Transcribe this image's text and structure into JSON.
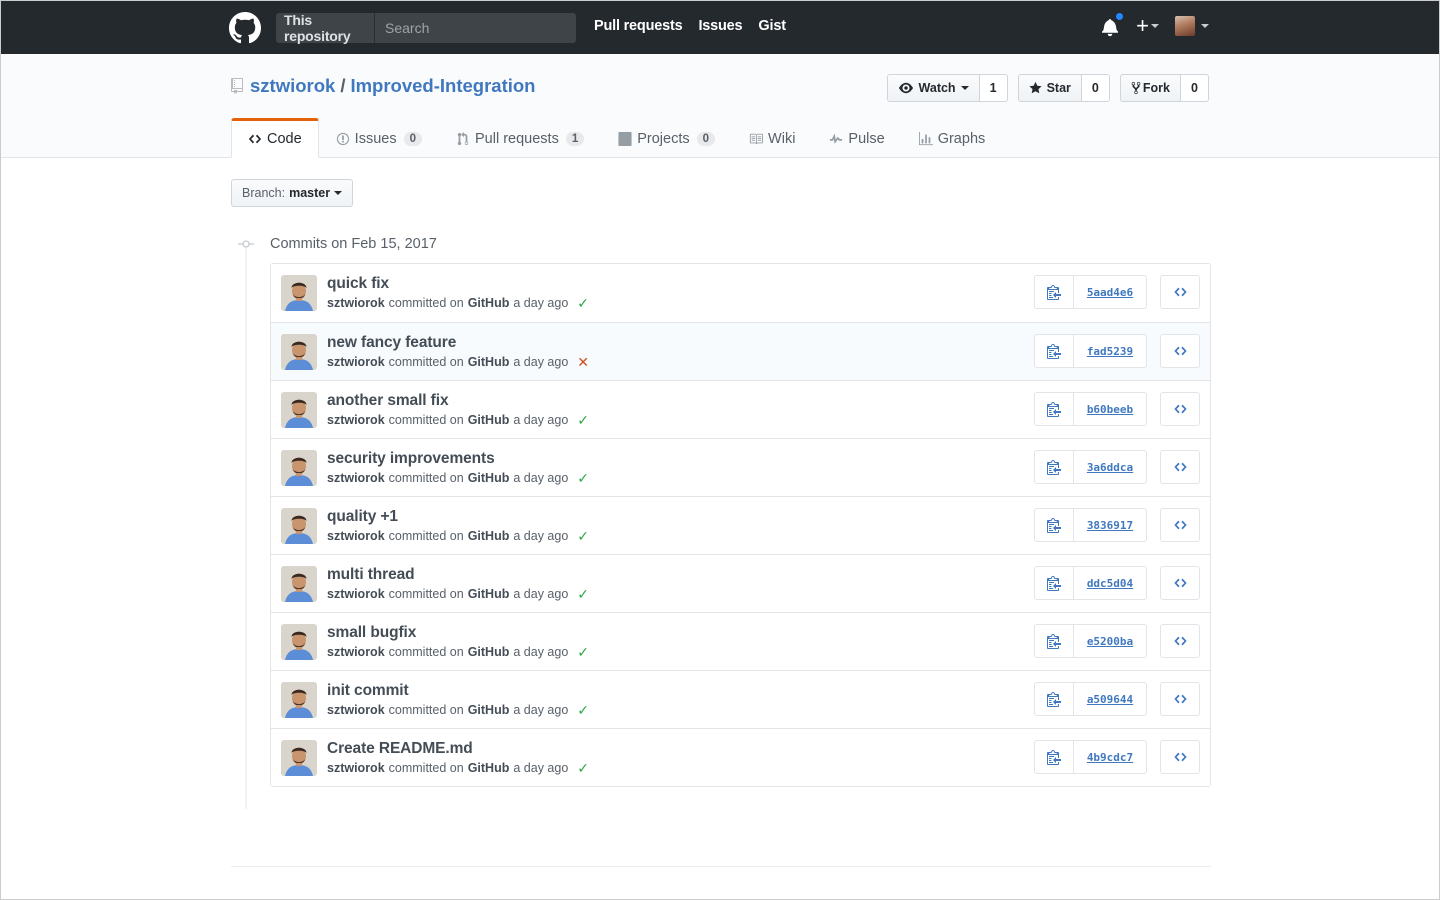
{
  "header": {
    "scope_label": "This repository",
    "search_placeholder": "Search",
    "nav": [
      "Pull requests",
      "Issues",
      "Gist"
    ],
    "icons": [
      "github-logo-icon",
      "bell-icon",
      "plus-icon",
      "avatar"
    ]
  },
  "repo": {
    "owner": "sztwiorok",
    "separator": "/",
    "name": "Improved-Integration",
    "actions": {
      "watch": {
        "label": "Watch",
        "count": "1"
      },
      "star": {
        "label": "Star",
        "count": "0"
      },
      "fork": {
        "label": "Fork",
        "count": "0"
      }
    },
    "tabs": [
      {
        "label": "Code",
        "icon": "code-icon",
        "selected": true
      },
      {
        "label": "Issues",
        "count": "0",
        "icon": "issue-icon"
      },
      {
        "label": "Pull requests",
        "count": "1",
        "icon": "pull-request-icon"
      },
      {
        "label": "Projects",
        "count": "0",
        "icon": "project-icon"
      },
      {
        "label": "Wiki",
        "icon": "book-icon"
      },
      {
        "label": "Pulse",
        "icon": "pulse-icon"
      },
      {
        "label": "Graphs",
        "icon": "graph-icon"
      }
    ]
  },
  "branch": {
    "prefix": "Branch:",
    "name": "master"
  },
  "commits_title": "Commits on Feb 15, 2017",
  "commit_meta": {
    "committed_on": "committed on",
    "platform": "GitHub"
  },
  "commits": [
    {
      "message": "quick fix",
      "author": "sztwiorok",
      "time": "a day ago",
      "status": "success",
      "sha": "5aad4e6"
    },
    {
      "message": "new fancy feature",
      "author": "sztwiorok",
      "time": "a day ago",
      "status": "failure",
      "sha": "fad5239"
    },
    {
      "message": "another small fix",
      "author": "sztwiorok",
      "time": "a day ago",
      "status": "success",
      "sha": "b60beeb"
    },
    {
      "message": "security improvements",
      "author": "sztwiorok",
      "time": "a day ago",
      "status": "success",
      "sha": "3a6ddca"
    },
    {
      "message": "quality +1",
      "author": "sztwiorok",
      "time": "a day ago",
      "status": "success",
      "sha": "3836917"
    },
    {
      "message": "multi thread",
      "author": "sztwiorok",
      "time": "a day ago",
      "status": "success",
      "sha": "ddc5d04"
    },
    {
      "message": "small bugfix",
      "author": "sztwiorok",
      "time": "a day ago",
      "status": "success",
      "sha": "e5200ba"
    },
    {
      "message": "init commit",
      "author": "sztwiorok",
      "time": "a day ago",
      "status": "success",
      "sha": "a509644"
    },
    {
      "message": "Create README.md",
      "author": "sztwiorok",
      "time": "a day ago",
      "status": "success",
      "sha": "4b9cdc7"
    }
  ],
  "status_glyphs": {
    "success": "✓",
    "failure": "✕"
  },
  "colors": {
    "link": "#4078c0",
    "selected_tab": "#e36209",
    "success": "#28a745",
    "failure": "#d24c1e",
    "header_bg": "#24292e"
  }
}
